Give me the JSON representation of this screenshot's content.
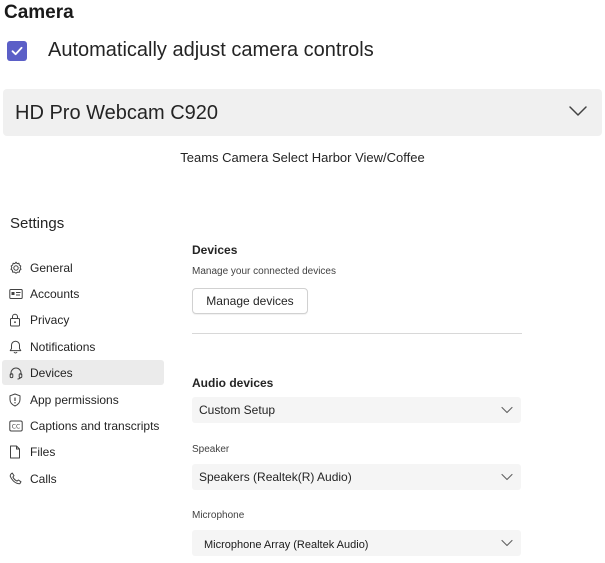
{
  "camera": {
    "title": "Camera",
    "auto_adjust_label": "Automatically adjust camera controls",
    "auto_adjust_checked": true,
    "selected_camera": "HD Pro Webcam C920",
    "background_caption": "Teams Camera Select Harbor View/Coffee"
  },
  "settings": {
    "title": "Settings",
    "nav": [
      {
        "label": "General",
        "icon": "gear-icon"
      },
      {
        "label": "Accounts",
        "icon": "id-card-icon"
      },
      {
        "label": "Privacy",
        "icon": "lock-icon"
      },
      {
        "label": "Notifications",
        "icon": "bell-icon"
      },
      {
        "label": "Devices",
        "icon": "headset-icon",
        "active": true
      },
      {
        "label": "App permissions",
        "icon": "shield-icon"
      },
      {
        "label": "Captions and transcripts",
        "icon": "cc-icon"
      },
      {
        "label": "Files",
        "icon": "file-icon"
      },
      {
        "label": "Calls",
        "icon": "phone-icon"
      }
    ],
    "devices": {
      "title": "Devices",
      "subtitle": "Manage your connected devices",
      "manage_button": "Manage devices"
    },
    "audio": {
      "title": "Audio devices",
      "setup_value": "Custom Setup",
      "speaker_label": "Speaker",
      "speaker_value": "Speakers (Realtek(R) Audio)",
      "microphone_label": "Microphone",
      "microphone_value": "Microphone Array (Realtek Audio)"
    }
  },
  "colors": {
    "accent": "#5b5fc7",
    "nav_active_bg": "#ebebeb",
    "dropdown_bg": "#f5f5f5"
  }
}
